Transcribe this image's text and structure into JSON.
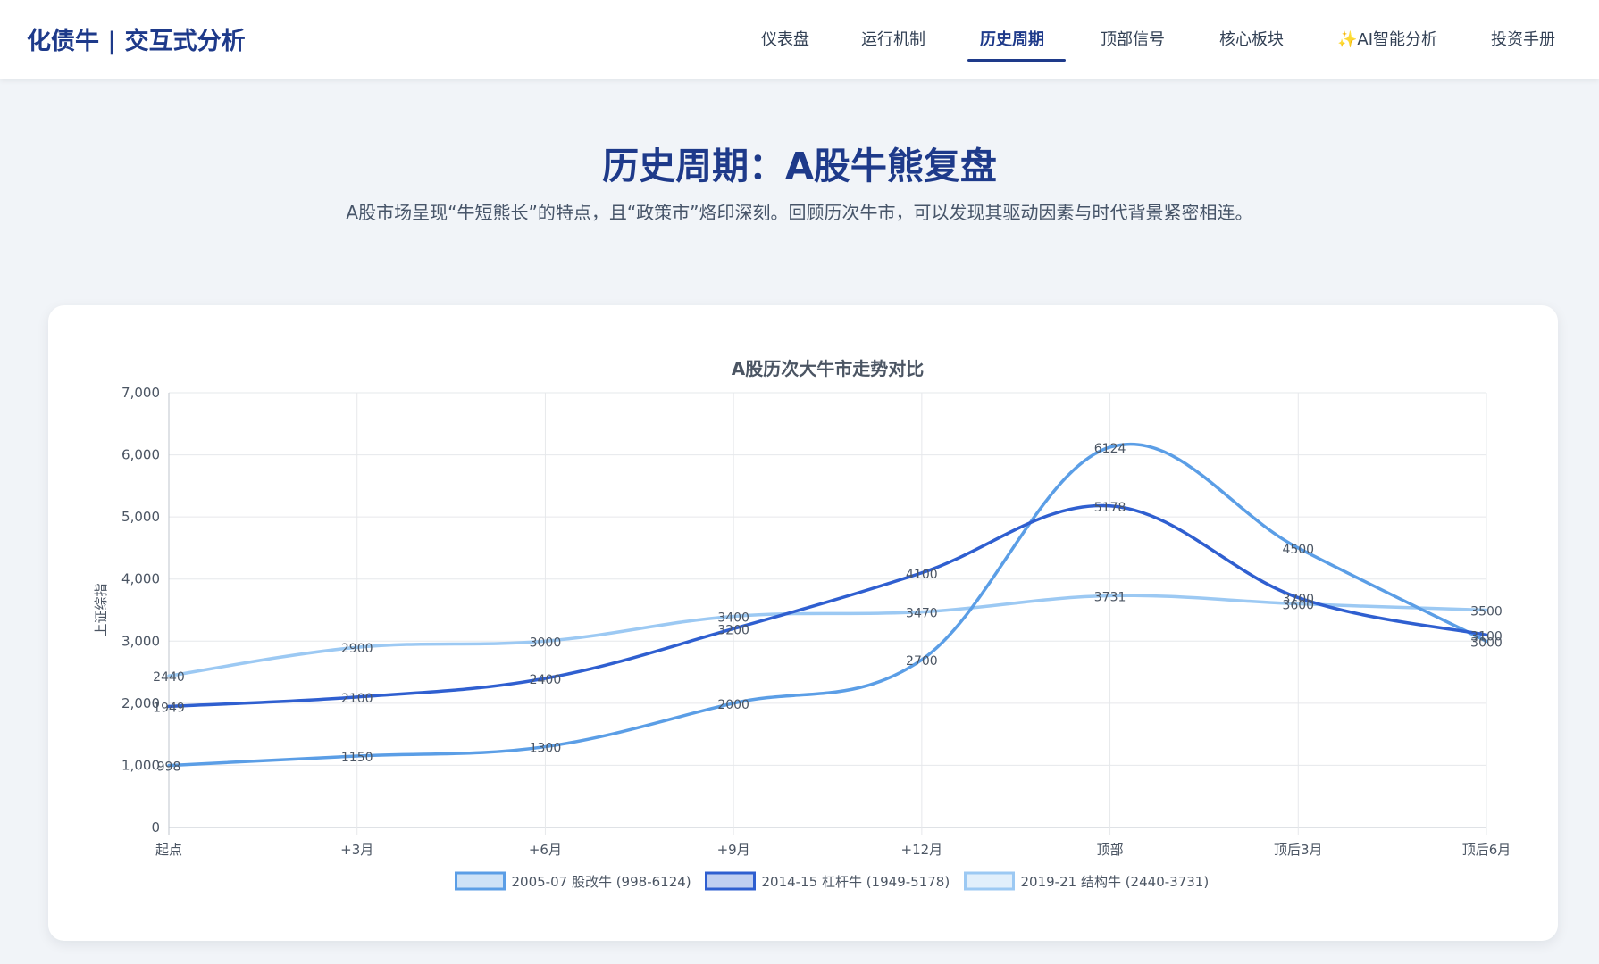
{
  "app": {
    "brand": "化债牛 | 交互式分析"
  },
  "nav": {
    "items": [
      {
        "label": "仪表盘",
        "active": false
      },
      {
        "label": "运行机制",
        "active": false
      },
      {
        "label": "历史周期",
        "active": true
      },
      {
        "label": "顶部信号",
        "active": false
      },
      {
        "label": "核心板块",
        "active": false
      },
      {
        "label": "✨AI智能分析",
        "active": false
      },
      {
        "label": "投资手册",
        "active": false
      }
    ]
  },
  "main": {
    "title": "历史周期：A股牛熊复盘",
    "subtitle": "A股市场呈现“牛短熊长”的特点，且“政策市”烙印深刻。回顾历次牛市，可以发现其驱动因素与时代背景紧密相连。"
  },
  "colors": {
    "brand": "#1e3a8a",
    "series_2005": "#5b9ee6",
    "series_2014": "#2f5fd0",
    "series_2019": "#9cc9f3"
  },
  "chart_data": {
    "type": "line",
    "title": "A股历次大牛市走势对比",
    "xlabel": "",
    "ylabel": "上证综指",
    "ylim": [
      0,
      7000
    ],
    "yticks": [
      "0",
      "1,000",
      "2,000",
      "3,000",
      "4,000",
      "5,000",
      "6,000",
      "7,000"
    ],
    "grid": true,
    "legend_position": "bottom",
    "categories": [
      "起点",
      "+3月",
      "+6月",
      "+9月",
      "+12月",
      "顶部",
      "顶后3月",
      "顶后6月"
    ],
    "series": [
      {
        "name": "2005-07 股改牛 (998-6124)",
        "color": "#5b9ee6",
        "values": [
          998,
          1150,
          1300,
          2000,
          2700,
          6124,
          4500,
          3000
        ]
      },
      {
        "name": "2014-15 杠杆牛 (1949-5178)",
        "color": "#2f5fd0",
        "values": [
          1949,
          2100,
          2400,
          3200,
          4100,
          5178,
          3700,
          3100
        ]
      },
      {
        "name": "2019-21 结构牛 (2440-3731)",
        "color": "#9cc9f3",
        "values": [
          2440,
          2900,
          3000,
          3400,
          3470,
          3731,
          3600,
          3500
        ]
      }
    ]
  }
}
